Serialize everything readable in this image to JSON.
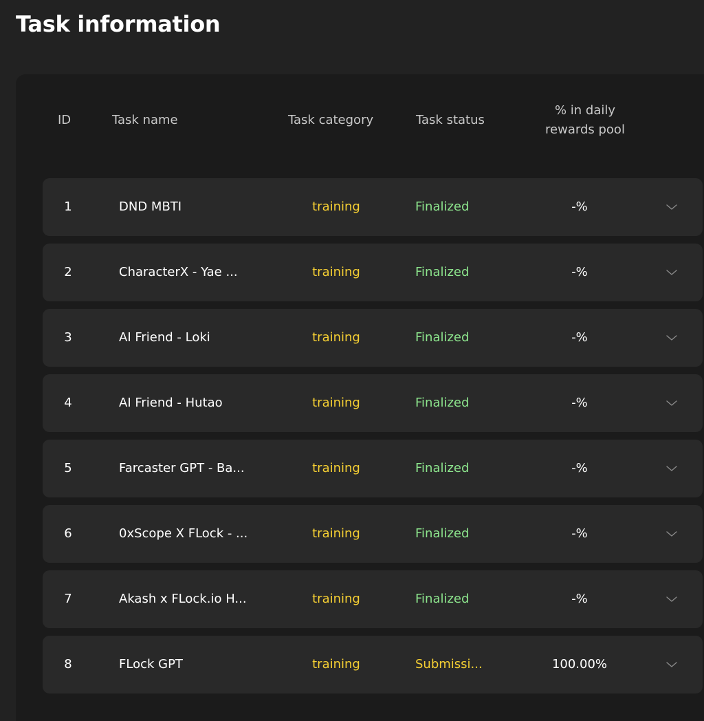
{
  "page": {
    "title": "Task information"
  },
  "table": {
    "headers": {
      "id": "ID",
      "name": "Task name",
      "category": "Task category",
      "status": "Task status",
      "pool_line1": "% in daily",
      "pool_line2": "rewards pool"
    },
    "rows": [
      {
        "id": "1",
        "name": "DND MBTI",
        "category": "training",
        "status": "Finalized",
        "pool": "-%",
        "expand_icon": "chevron-down-icon"
      },
      {
        "id": "2",
        "name": "CharacterX - Yae ...",
        "category": "training",
        "status": "Finalized",
        "pool": "-%",
        "expand_icon": "chevron-down-icon"
      },
      {
        "id": "3",
        "name": "AI Friend - Loki",
        "category": "training",
        "status": "Finalized",
        "pool": "-%",
        "expand_icon": "chevron-down-icon"
      },
      {
        "id": "4",
        "name": "AI Friend - Hutao",
        "category": "training",
        "status": "Finalized",
        "pool": "-%",
        "expand_icon": "chevron-down-icon"
      },
      {
        "id": "5",
        "name": "Farcaster GPT - Ba...",
        "category": "training",
        "status": "Finalized",
        "pool": "-%",
        "expand_icon": "chevron-down-icon"
      },
      {
        "id": "6",
        "name": "0xScope X FLock - ...",
        "category": "training",
        "status": "Finalized",
        "pool": "-%",
        "expand_icon": "chevron-down-icon"
      },
      {
        "id": "7",
        "name": "Akash x FLock.io H...",
        "category": "training",
        "status": "Finalized",
        "pool": "-%",
        "expand_icon": "chevron-down-icon"
      },
      {
        "id": "8",
        "name": "FLock GPT",
        "category": "training",
        "status": "Submissi...",
        "pool": "100.00%",
        "expand_icon": "chevron-down-icon"
      }
    ]
  },
  "colors": {
    "background": "#222222",
    "panel": "#1b1b1b",
    "row": "#292929",
    "category": "#f5cf33",
    "status_finalized": "#8de58d",
    "status_submission": "#f5cf33"
  }
}
